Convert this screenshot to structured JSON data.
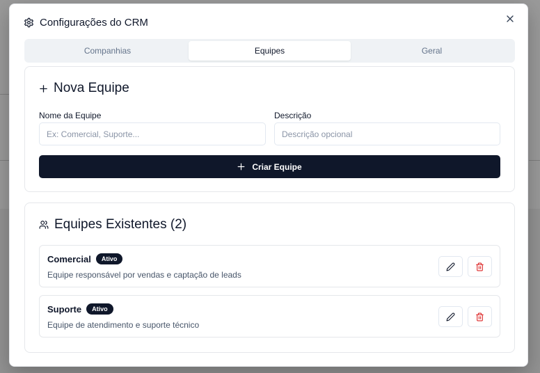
{
  "dialog": {
    "title": "Configurações do CRM",
    "close_label": "×"
  },
  "tabs": [
    {
      "label": "Companhias",
      "active": false
    },
    {
      "label": "Equipes",
      "active": true
    },
    {
      "label": "Geral",
      "active": false
    }
  ],
  "new_team": {
    "title": "Nova Equipe",
    "name_label": "Nome da Equipe",
    "name_placeholder": "Ex: Comercial, Suporte...",
    "name_value": "",
    "description_label": "Descrição",
    "description_placeholder": "Descrição opcional",
    "description_value": "",
    "create_button": "Criar Equipe"
  },
  "existing_teams": {
    "title": "Equipes Existentes (2)",
    "teams": [
      {
        "name": "Comercial",
        "status": "Ativo",
        "description": "Equipe responsável por vendas e captação de leads"
      },
      {
        "name": "Suporte",
        "status": "Ativo",
        "description": "Equipe de atendimento e suporte técnico"
      }
    ]
  },
  "colors": {
    "primary": "#0f172a",
    "danger": "#dc2626",
    "tab_bg": "#eff2f5",
    "backdrop": "#9a9a9a"
  }
}
